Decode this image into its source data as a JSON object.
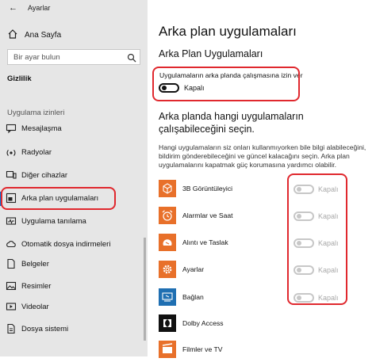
{
  "window": {
    "title": "Ayarlar"
  },
  "sidebar": {
    "home_label": "Ana Sayfa",
    "search_placeholder": "Bir ayar bulun",
    "section_title": "Gizlilik",
    "group_title": "Uygulama izinleri",
    "items": [
      {
        "label": "Mesajlaşma",
        "icon": "message-icon"
      },
      {
        "label": "Radyolar",
        "icon": "radio-icon"
      },
      {
        "label": "Diğer cihazlar",
        "icon": "devices-icon"
      },
      {
        "label": "Arka plan uygulamaları",
        "icon": "background-apps-icon",
        "active": true
      },
      {
        "label": "Uygulama tanılama",
        "icon": "diagnostics-icon"
      },
      {
        "label": "Otomatik dosya indirmeleri",
        "icon": "cloud-icon"
      },
      {
        "label": "Belgeler",
        "icon": "document-icon"
      },
      {
        "label": "Resimler",
        "icon": "pictures-icon"
      },
      {
        "label": "Videolar",
        "icon": "video-icon"
      },
      {
        "label": "Dosya sistemi",
        "icon": "filesystem-icon"
      }
    ]
  },
  "main": {
    "page_title": "Arka plan uygulamaları",
    "subtitle": "Arka Plan Uygulamaları",
    "allow_label": "Uygulamaların arka planda çalışmasına izin ver",
    "allow_state": "Kapalı",
    "choose_title": "Arka planda hangi uygulamaların çalışabileceğini seçin.",
    "choose_desc": "Hangi uygulamaların siz onları kullanmıyorken bile bilgi alabileceğini, bildirim gönderebileceğini ve güncel kalacağını seçin. Arka plan uygulamalarını kapatmak güç korumasına yardımcı olabilir.",
    "apps": [
      {
        "name": "3B Görüntüleyici",
        "state": "Kapalı",
        "icon": "3d-viewer-icon",
        "color": "#e8702a"
      },
      {
        "name": "Alarmlar ve Saat",
        "state": "Kapalı",
        "icon": "alarm-clock-icon",
        "color": "#e8702a"
      },
      {
        "name": "Alıntı ve Taslak",
        "state": "Kapalı",
        "icon": "snip-sketch-icon",
        "color": "#e8702a"
      },
      {
        "name": "Ayarlar",
        "state": "Kapalı",
        "icon": "gear-icon",
        "color": "#e8702a"
      },
      {
        "name": "Bağlan",
        "state": "Kapalı",
        "icon": "connect-icon",
        "color": "#1f6fb2"
      },
      {
        "name": "Dolby Access",
        "state": "",
        "icon": "dolby-icon",
        "color": "#111111"
      },
      {
        "name": "Filmler ve TV",
        "state": "",
        "icon": "movies-tv-icon",
        "color": "#e8702a"
      }
    ]
  },
  "colors": {
    "annotation": "#e0282e",
    "accent": "#0078d7",
    "app_tile": "#e8702a"
  }
}
